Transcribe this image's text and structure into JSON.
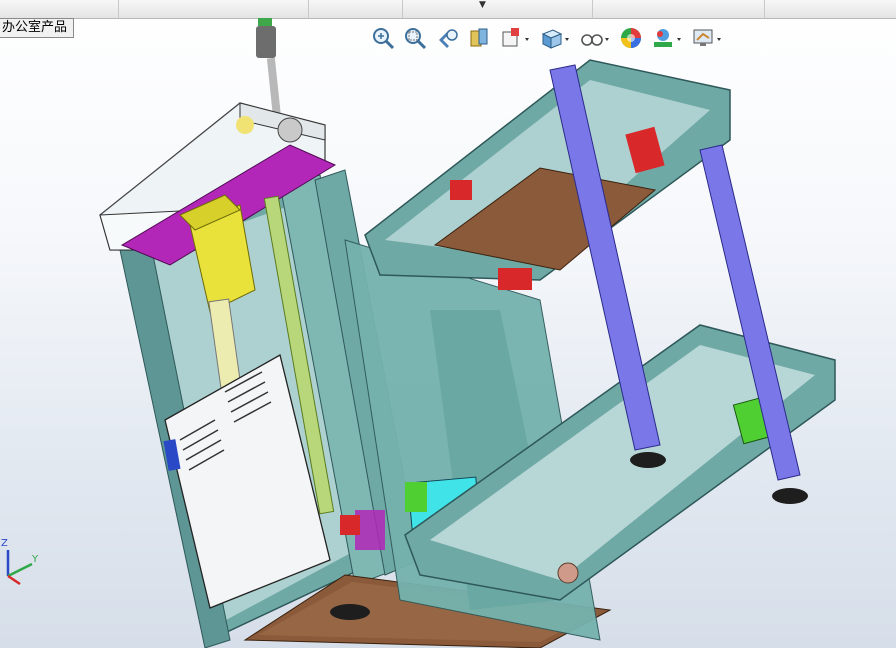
{
  "window": {
    "tree_label": "办公室产品"
  },
  "heads_up_toolbar": [
    {
      "id": "zoom-to-fit",
      "icon": "zoom-to-fit-icon"
    },
    {
      "id": "zoom-to-area",
      "icon": "zoom-to-area-icon"
    },
    {
      "id": "previous-view",
      "icon": "previous-view-icon"
    },
    {
      "id": "section-view",
      "icon": "section-view-icon"
    },
    {
      "id": "view-orientation",
      "icon": "view-orientation-icon",
      "dropdown": true
    },
    {
      "id": "display-style",
      "icon": "display-style-icon",
      "dropdown": true
    },
    {
      "id": "hide-show-items",
      "icon": "hide-show-items-icon",
      "dropdown": true
    },
    {
      "id": "edit-appearance",
      "icon": "edit-appearance-icon"
    },
    {
      "id": "apply-scene",
      "icon": "apply-scene-icon",
      "dropdown": true
    },
    {
      "id": "view-settings",
      "icon": "view-settings-icon",
      "dropdown": true
    }
  ],
  "triad": {
    "x": "X",
    "y": "Y",
    "z": "Z"
  },
  "colors": {
    "frame": "#6fa9a6",
    "frame_dark": "#3f7476",
    "purple_rail": "#7a78e8",
    "plate": "#8a5a3a",
    "red_block": "#d9282a",
    "green_block": "#4fcf32",
    "motor": "#e8e23a",
    "magenta": "#b327b8",
    "cyan_box": "#3fe3e8",
    "glass": "#e6eef2"
  }
}
